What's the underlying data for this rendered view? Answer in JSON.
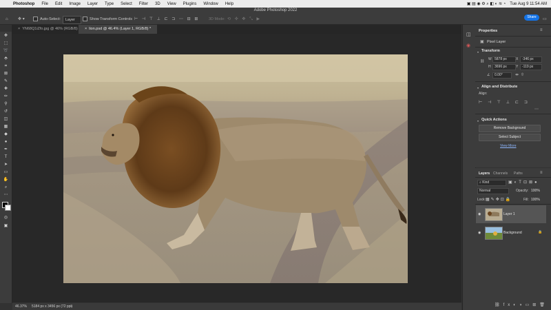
{
  "menubar": {
    "apple": "",
    "items": [
      "Photoshop",
      "File",
      "Edit",
      "Image",
      "Layer",
      "Type",
      "Select",
      "Filter",
      "3D",
      "View",
      "Plugins",
      "Window",
      "Help"
    ],
    "clock": "Tue Aug 9  11:54 AM"
  },
  "window_title": "Adobe Photoshop 2022",
  "options": {
    "auto_select_label": "Auto-Select:",
    "auto_select_value": "Layer",
    "show_transform_label": "Show Transform Controls",
    "mode_3d": "3D Mode:",
    "share_label": "Share"
  },
  "tabs": [
    {
      "label": "YN68Q1iZfo.jpg @ 46% (RGB/8)"
    },
    {
      "label": "lion.psd @ 46.4% (Layer 1, RGB/8) *"
    }
  ],
  "status": {
    "zoom": "46.37%",
    "doc_info": "5184 px x 3456 px (72 ppi)"
  },
  "properties": {
    "tab_label": "Properties",
    "kind": "Pixel Layer",
    "transform_title": "Transform",
    "w_label": "W",
    "w_value": "5878 px",
    "x_label": "X",
    "x_value": "-346 px",
    "h_label": "H",
    "h_value": "3696 px",
    "y_label": "Y",
    "y_value": "-119 px",
    "angle_value": "0.00°",
    "align_title": "Align and Distribute",
    "align_label": "Align:",
    "quick_title": "Quick Actions",
    "remove_bg": "Remove Background",
    "select_subject": "Select Subject",
    "view_more": "View More"
  },
  "layers_panel": {
    "tabs": [
      "Layers",
      "Channels",
      "Paths"
    ],
    "kind_filter": "Kind",
    "blend_mode": "Normal",
    "opacity_label": "Opacity:",
    "opacity_value": "100%",
    "lock_label": "Lock:",
    "fill_label": "Fill:",
    "fill_value": "100%",
    "layers": [
      {
        "name": "Layer 1",
        "selected": true
      },
      {
        "name": "Background",
        "selected": false
      }
    ]
  }
}
